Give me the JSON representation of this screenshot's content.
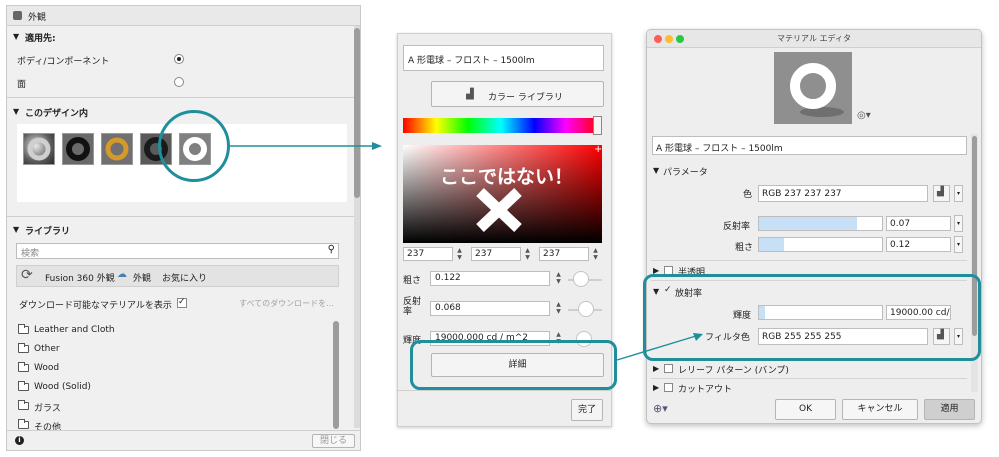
{
  "appearance_panel": {
    "title": "外観",
    "apply_to": {
      "heading": "適用先:",
      "options": [
        {
          "label": "ボディ/コンポーネント",
          "selected": true
        },
        {
          "label": "面",
          "selected": false
        }
      ]
    },
    "in_design": {
      "heading": "このデザイン内",
      "thumbnails": [
        "chrome",
        "black-rubber",
        "gold",
        "dark-gloss",
        "white-emissive"
      ]
    },
    "library": {
      "heading": "ライブラリ",
      "search_placeholder": "検索",
      "tabs": [
        "Fusion 360 外観",
        "外観",
        "お気に入り"
      ],
      "downloadable_label": "ダウンロード可能なマテリアルを表示",
      "downloadable_checked": true,
      "all_downloads_link": "すべてのダウンロードを...",
      "folders": [
        "Leather and Cloth",
        "Other",
        "Wood",
        "Wood (Solid)",
        "ガラス",
        "その他"
      ]
    },
    "close_button": "閉じる"
  },
  "color_picker": {
    "name": "A 形電球 – フロスト – 1500lm",
    "library_button": "カラー ライブラリ",
    "overlay_text": "ここではない！",
    "rgb": [
      "237",
      "237",
      "237"
    ],
    "roughness": {
      "label": "粗さ",
      "value": "0.122"
    },
    "reflectance": {
      "label": "反射\n率",
      "value": "0.068"
    },
    "luminance": {
      "label": "輝度",
      "value": "19000.000 cd / m^2"
    },
    "details_button": "詳細",
    "done_button": "完了"
  },
  "material_editor": {
    "title": "マテリアル エディタ",
    "name": "A 形電球 – フロスト – 1500lm",
    "params_heading": "パラメータ",
    "color": {
      "label": "色",
      "value": "RGB 237 237 237"
    },
    "reflectance": {
      "label": "反射率",
      "value": "0.07",
      "fill": 0.8
    },
    "roughness": {
      "label": "粗さ",
      "value": "0.12",
      "fill": 0.2
    },
    "transparency_heading": "半透明",
    "emission_heading": "放射率",
    "luminance": {
      "label": "輝度",
      "value": "19000.00 cd/",
      "fill": 0.05
    },
    "filter_color": {
      "label": "フィルタ色",
      "value": "RGB 255 255 255"
    },
    "relief_heading": "レリーフ パターン (バンプ)",
    "cutout_heading": "カットアウト",
    "ok_button": "OK",
    "cancel_button": "キャンセル",
    "apply_button": "適用"
  },
  "colors": {
    "annotation": "#1f8f9c",
    "apply_button_bg": "#cfcfcf"
  }
}
